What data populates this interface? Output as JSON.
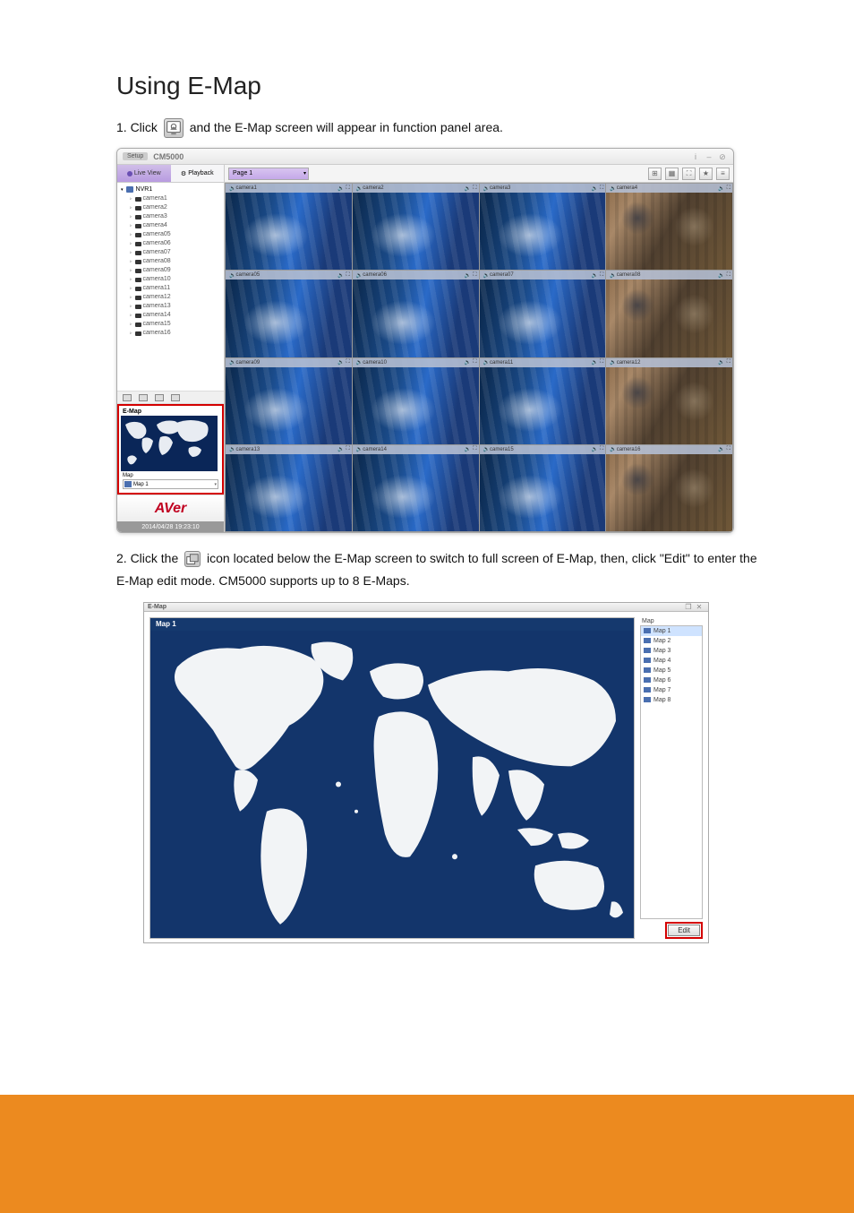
{
  "heading": "Using E-Map",
  "step1_prefix": "1. Click",
  "step1_suffix": "and the E-Map screen will appear in function panel area.",
  "app": {
    "setup": "Setup",
    "title": "CM5000",
    "tabs": {
      "live": "Live View",
      "playback": "Playback"
    },
    "page_select": "Page 1",
    "toolbar_icons": [
      "grid-layout",
      "layout-small",
      "fullscreen",
      "favorite",
      "settings"
    ],
    "nvr_name": "NVR1",
    "cameras": [
      "camera1",
      "camera2",
      "camera3",
      "camera4",
      "camera05",
      "camera06",
      "camera07",
      "camera08",
      "camera09",
      "camera10",
      "camera11",
      "camera12",
      "camera13",
      "camera14",
      "camera15",
      "camera16"
    ],
    "emap_panel": {
      "title": "E-Map",
      "label": "Map",
      "selected": "Map 1"
    },
    "logo": "AVer",
    "timestamp": "2014/04/28 19:23:10",
    "grid_cells": [
      {
        "label": "camera1",
        "style": "control"
      },
      {
        "label": "camera2",
        "style": "control"
      },
      {
        "label": "camera3",
        "style": "control"
      },
      {
        "label": "camera4",
        "style": "store"
      },
      {
        "label": "camera05",
        "style": "control"
      },
      {
        "label": "camera06",
        "style": "control"
      },
      {
        "label": "camera07",
        "style": "control"
      },
      {
        "label": "camera08",
        "style": "store"
      },
      {
        "label": "camera09",
        "style": "control"
      },
      {
        "label": "camera10",
        "style": "control"
      },
      {
        "label": "camera11",
        "style": "control"
      },
      {
        "label": "camera12",
        "style": "store"
      },
      {
        "label": "camera13",
        "style": "control"
      },
      {
        "label": "camera14",
        "style": "control"
      },
      {
        "label": "camera15",
        "style": "control"
      },
      {
        "label": "camera16",
        "style": "store"
      }
    ]
  },
  "step2_prefix": "2. Click the",
  "step2_suffix": " icon located below the E-Map screen to switch to full screen of E-Map, then, click \"Edit\" to enter the E-Map edit mode. CM5000 supports up to 8 E-Maps.",
  "shot2": {
    "window_title": "E-Map",
    "map_title": "Map 1",
    "side_title": "Map",
    "maps": [
      "Map 1",
      "Map 2",
      "Map 3",
      "Map 4",
      "Map 5",
      "Map 6",
      "Map 7",
      "Map 8"
    ],
    "edit_label": "Edit"
  }
}
